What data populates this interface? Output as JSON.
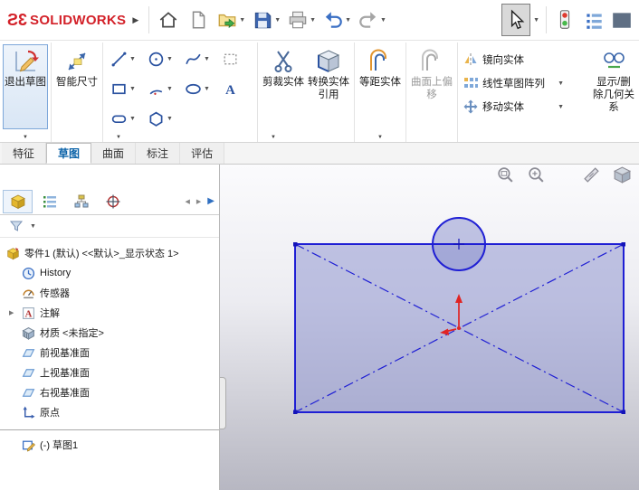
{
  "colors": {
    "brand_red": "#d32129",
    "sketch_edge_blue": "#1f1fd4",
    "sketch_fill": "#8a90ce",
    "origin_red": "#e02424",
    "viewport_gradient_bottom": "#b7b7c2"
  },
  "titlebar": {
    "brand_mark": "3S",
    "brand": "SOLIDWORKS",
    "buttons": [
      "home",
      "new-document",
      "open",
      "save",
      "print",
      "undo",
      "redo",
      "select",
      "stoplight",
      "list"
    ]
  },
  "ribbon": {
    "exit_sketch": "退出草图",
    "smart_dimension": "智能尺寸",
    "trim_entities": "剪裁实体",
    "convert_entities": "转换实体引用",
    "offset_entities": "等距实体",
    "surface_offset": "曲面上偏移",
    "mirror_entities": "镜向实体",
    "linear_pattern": "线性草图阵列",
    "move_entities": "移动实体",
    "display_relations": "显示/删除几何关系"
  },
  "tabs": [
    {
      "label": "特征",
      "active": false
    },
    {
      "label": "草图",
      "active": true
    },
    {
      "label": "曲面",
      "active": false
    },
    {
      "label": "标注",
      "active": false
    },
    {
      "label": "评估",
      "active": false
    }
  ],
  "left_panel": {
    "tabs": [
      "feature-manager",
      "property-manager",
      "configuration-manager",
      "dimxpert-manager"
    ]
  },
  "feature_tree": {
    "root": "零件1 (默认) <<默认>_显示状态 1>",
    "items": [
      {
        "label": "History"
      },
      {
        "label": "传感器"
      },
      {
        "label": "注解"
      },
      {
        "label": "材质 <未指定>"
      },
      {
        "label": "前视基准面"
      },
      {
        "label": "上视基准面"
      },
      {
        "label": "右视基准面"
      },
      {
        "label": "原点"
      },
      {
        "label": "(-) 草图1"
      }
    ]
  },
  "viewport": {
    "hud_icons": [
      "zoom-fit",
      "zoom-area",
      "section-view",
      "view-orientation"
    ],
    "sketch_entities": [
      "rectangle-with-diagonal-centerlines",
      "circle-centered-on-top-edge",
      "origin-arrows-at-center"
    ]
  },
  "icons": {
    "home": "house",
    "new-document": "blank-page",
    "open": "folder-with-green-arrow",
    "save": "blue-floppy-disk",
    "print": "printer",
    "undo": "curved-arrow-left",
    "redo": "curved-arrow-right",
    "select": "cursor-arrow",
    "stoplight": "traffic-light-red-green",
    "filter": "funnel"
  }
}
